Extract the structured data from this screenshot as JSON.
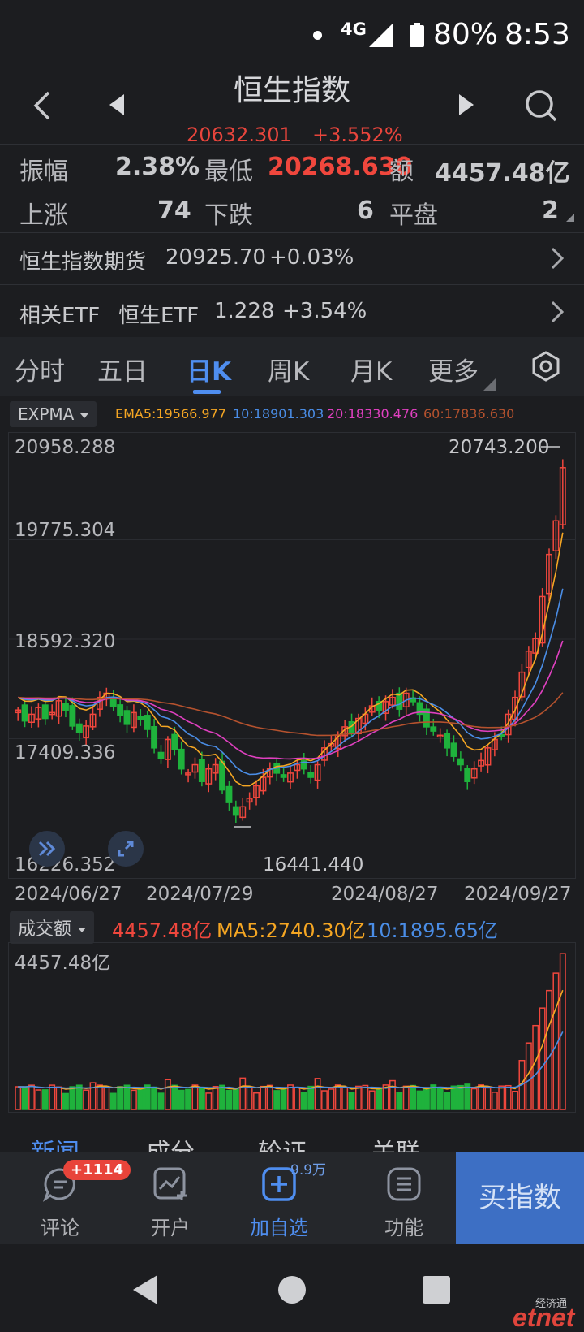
{
  "status": {
    "network": "4G",
    "battery": "80%",
    "time": "8:53"
  },
  "header": {
    "title": "恒生指数",
    "price": "20632.301",
    "change": "+3.552%"
  },
  "stats": [
    {
      "label": "振幅",
      "value": "2.38%"
    },
    {
      "label": "最低",
      "value": "20268.630"
    },
    {
      "label": "额",
      "value": "4457.48亿"
    },
    {
      "label": "上涨",
      "value": "74"
    },
    {
      "label": "下跌",
      "value": "6"
    },
    {
      "label": "平盘",
      "value": "2"
    }
  ],
  "futures": {
    "label": "恒生指数期货",
    "price": "20925.70",
    "change": "+0.03%"
  },
  "etf": {
    "label": "相关ETF",
    "name": "恒生ETF",
    "price": "1.228",
    "change": "+3.54%"
  },
  "tabs": [
    {
      "label": "分时"
    },
    {
      "label": "五日"
    },
    {
      "label": "日K"
    },
    {
      "label": "周K"
    },
    {
      "label": "月K"
    },
    {
      "label": "更多"
    }
  ],
  "indicator": {
    "select": "EXPMA",
    "ema5": "EMA5:19566.977",
    "ema10": "10:18901.303",
    "ema20": "20:18330.476",
    "ema60": "60:17836.630"
  },
  "colors": {
    "up": "#f0473d",
    "down": "#1fb23c",
    "ema5": "#f5a623",
    "ema10": "#4a8de6",
    "ema20": "#e040c0",
    "ema60": "#b5522e",
    "accent": "#4f8ef0"
  },
  "price_axis": [
    "20958.288",
    "19775.304",
    "18592.320",
    "17409.336",
    "16226.352"
  ],
  "price_annot": {
    "high": "20743.200",
    "low": "16441.440"
  },
  "dates": [
    "2024/06/27",
    "2024/07/29",
    "2024/08/27",
    "2024/09/27"
  ],
  "volume": {
    "select": "成交额",
    "current": "4457.48亿",
    "ma5": "MA5:2740.30亿",
    "ma10": "10:1895.65亿",
    "axis_top": "4457.48亿"
  },
  "news_tabs": [
    {
      "label": "新闻"
    },
    {
      "label": "成分"
    },
    {
      "label": "轮证"
    },
    {
      "label": "关联"
    }
  ],
  "bottom": {
    "comment": "评论",
    "badge": "+1114",
    "open": "开户",
    "add": "加自选",
    "add_count": "9.9万",
    "func": "功能",
    "buy": "买指数"
  },
  "watermark": {
    "cn": "经济通",
    "en": "etnet"
  },
  "chart_data": {
    "type": "candlestick",
    "title": "",
    "ylim": [
      16226.352,
      20958.288
    ],
    "x_ticks": [
      "2024/06/27",
      "2024/07/29",
      "2024/08/27",
      "2024/09/27"
    ],
    "series": [
      {
        "name": "EMA5",
        "values": [
          19566.977
        ]
      },
      {
        "name": "10",
        "values": [
          18901.303
        ]
      },
      {
        "name": "20",
        "values": [
          18330.476
        ]
      },
      {
        "name": "60",
        "values": [
          17836.63
        ]
      }
    ],
    "annotations": {
      "high": 20743.2,
      "low": 16441.44
    },
    "volume_ma": {
      "MA5": "2740.30亿",
      "10": "1895.65亿",
      "latest": "4457.48亿"
    }
  }
}
